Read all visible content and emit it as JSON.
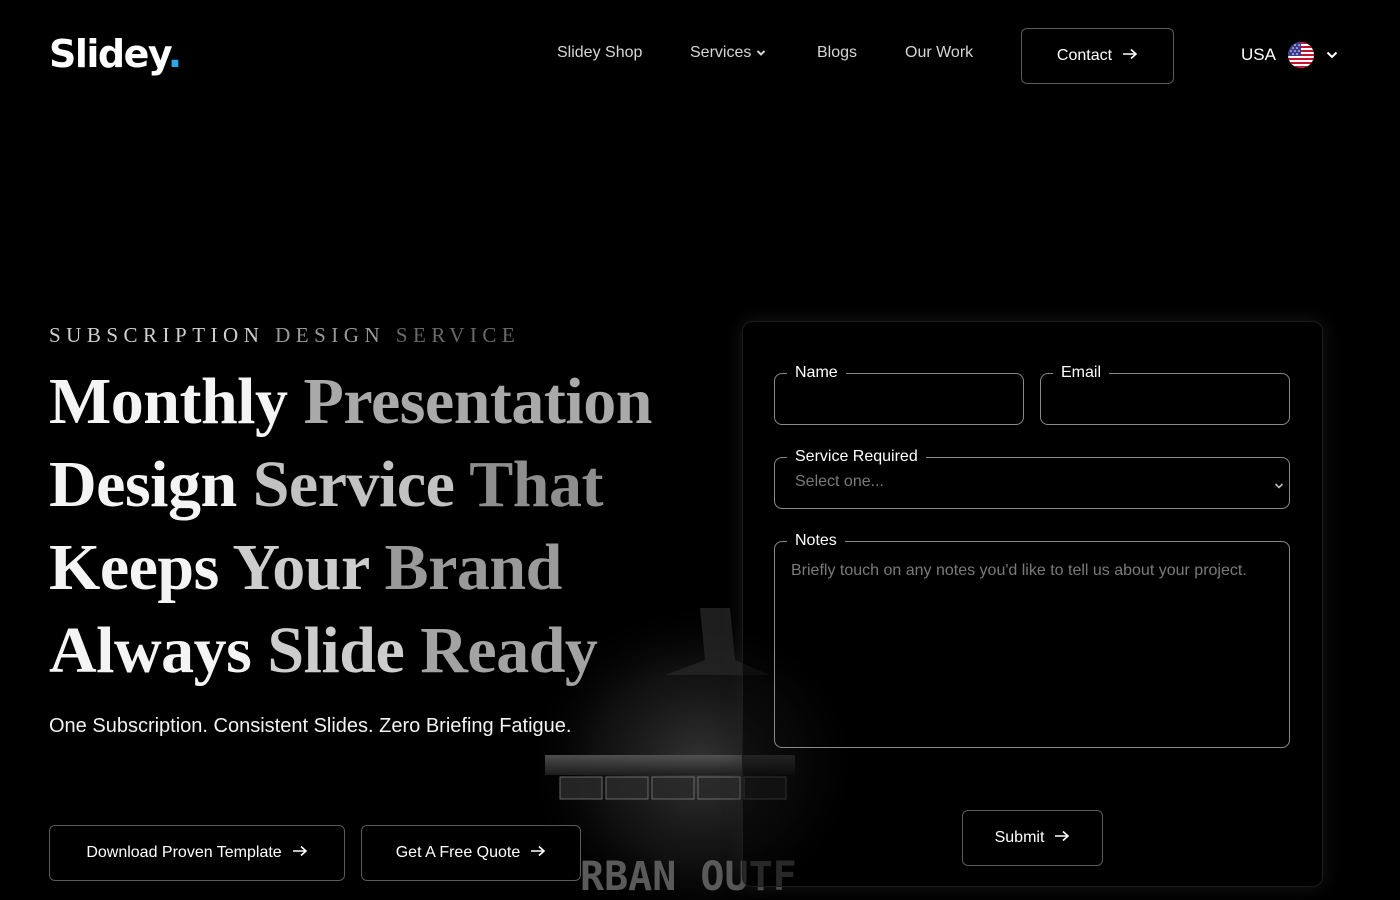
{
  "brand": {
    "logo_text": "Slidey",
    "logo_dot": ".",
    "accent_color": "#2aa7e8"
  },
  "nav": {
    "items": [
      {
        "label": "Slidey Shop"
      },
      {
        "label": "Services",
        "has_dropdown": true
      },
      {
        "label": "Blogs"
      },
      {
        "label": "Our Work"
      }
    ],
    "contact_label": "Contact",
    "locale": {
      "label": "USA",
      "flag_icon": "us-flag-icon"
    }
  },
  "hero": {
    "eyebrow": [
      "SUBSCRIPTION",
      "DESIGN",
      "SERVICE"
    ],
    "headline_lines": [
      [
        "Monthly",
        "Presentation"
      ],
      [
        "Design",
        "Service",
        "That"
      ],
      [
        "Keeps",
        "Your",
        "Brand"
      ],
      [
        "Always",
        "Slide",
        "Ready"
      ]
    ],
    "subline": "One Subscription. Consistent Slides. Zero Briefing Fatigue.",
    "buttons": {
      "download_label": "Download Proven Template",
      "quote_label": "Get A Free Quote"
    },
    "background_image_text": "RBAN OUTF"
  },
  "form": {
    "name_label": "Name",
    "email_label": "Email",
    "service_label": "Service Required",
    "service_placeholder": "Select one...",
    "notes_label": "Notes",
    "notes_placeholder": "Briefly touch on any notes you'd like to tell us about your project.",
    "submit_label": "Submit"
  }
}
